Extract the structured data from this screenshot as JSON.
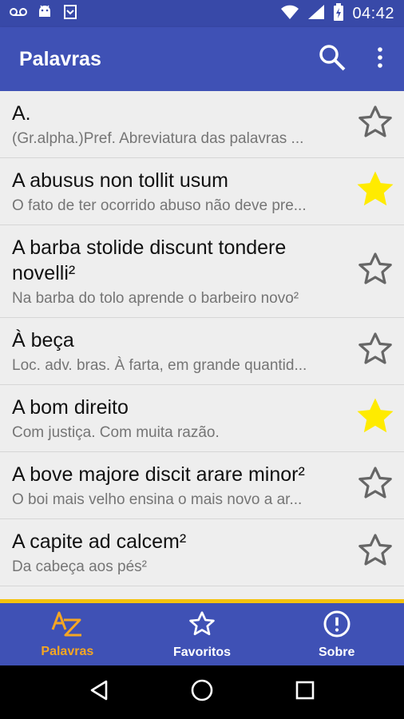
{
  "status_bar": {
    "time": "04:42",
    "icons_left": [
      "voicemail-icon",
      "android-icon",
      "download-icon"
    ],
    "icons_right": [
      "wifi-icon",
      "signal-icon",
      "battery-icon"
    ]
  },
  "app_bar": {
    "title": "Palavras",
    "actions": [
      "search-icon",
      "more-vert-icon"
    ]
  },
  "entries": [
    {
      "title": "A.",
      "description": "(Gr.alpha.)Pref. Abreviatura das palavras ...",
      "favorite": false
    },
    {
      "title": "A abusus non tollit usum",
      "description": "O fato de ter ocorrido abuso não deve pre...",
      "favorite": true
    },
    {
      "title": "A barba stolide discunt tondere novelli²",
      "description": "Na barba do tolo aprende o barbeiro novo²",
      "favorite": false
    },
    {
      "title": "À beça",
      "description": "Loc. adv. bras. À farta, em grande quantid...",
      "favorite": false
    },
    {
      "title": "A bom direito",
      "description": " Com justiça. Com muita razão.",
      "favorite": true
    },
    {
      "title": "A bove majore discit arare minor²",
      "description": "O boi mais velho ensina o mais novo a ar...",
      "favorite": false
    },
    {
      "title": "A capite ad calcem²",
      "description": "Da cabeça aos pés²",
      "favorite": false
    }
  ],
  "bottom_nav": {
    "items": [
      {
        "label": "Palavras",
        "icon": "az-icon",
        "active": true
      },
      {
        "label": "Favoritos",
        "icon": "star-outline-icon",
        "active": false
      },
      {
        "label": "Sobre",
        "icon": "info-icon",
        "active": false
      }
    ]
  },
  "colors": {
    "primary": "#3f51b5",
    "primary_dark": "#3849a8",
    "accent": "#f5a623",
    "star_filled": "#ffeb00",
    "divider_accent": "#f4c20d"
  }
}
